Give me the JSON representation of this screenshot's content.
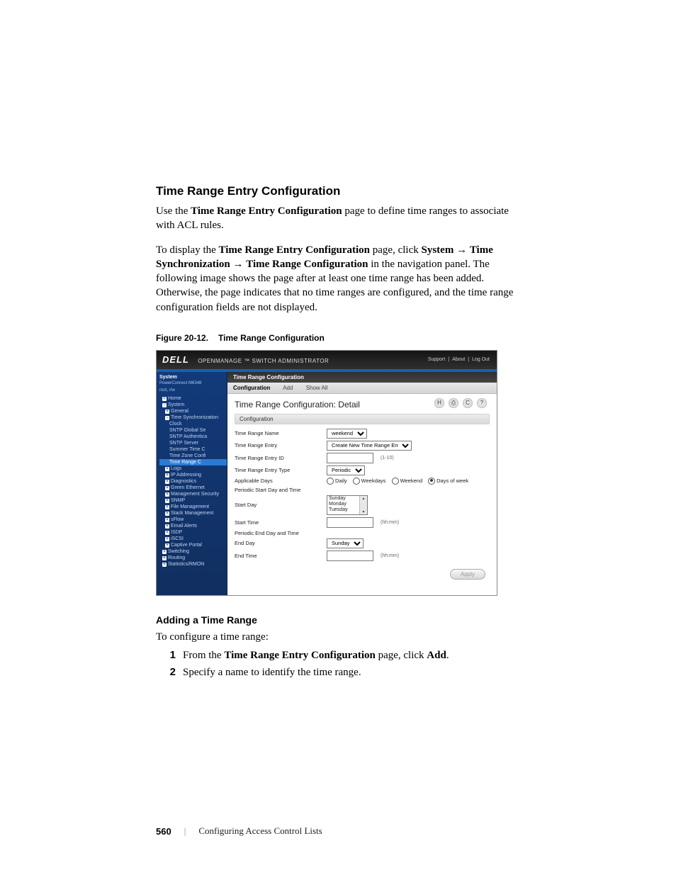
{
  "section_title": "Time Range Entry Configuration",
  "para1_a": "Use the ",
  "para1_b": "Time Range Entry Configuration",
  "para1_c": " page to define time ranges to associate with ACL rules.",
  "para2_a": "To display the ",
  "para2_b": "Time Range Entry Configuration",
  "para2_c": " page, click ",
  "para2_d": "System",
  "para2_e": "Time Synchronization",
  "para2_f": "Time Range Configuration",
  "para2_g": " in the navigation panel. The following image shows the page after at least one time range has been added. Otherwise, the page indicates that no time ranges are configured, and the time range configuration fields are not displayed.",
  "arrow": "→",
  "figure_caption_a": "Figure 20-12.",
  "figure_caption_b": "Time Range Configuration",
  "shot": {
    "brand": "DELL",
    "subbrand": "OPENMANAGE ™ SWITCH ADMINISTRATOR",
    "links": [
      "Support",
      "About",
      "Log Out"
    ],
    "side_title": "System",
    "side_info1": "PowerConnect M6348",
    "side_info2": "root, r/w",
    "tree": [
      {
        "t": "Home",
        "lv": 0,
        "e": "="
      },
      {
        "t": "System",
        "lv": 0,
        "e": "-"
      },
      {
        "t": "General",
        "lv": 1,
        "e": "+"
      },
      {
        "t": "Time Synchronization",
        "lv": 1,
        "e": "-"
      },
      {
        "t": "Clock",
        "lv": 2
      },
      {
        "t": "SNTP Global Se",
        "lv": 2
      },
      {
        "t": "SNTP Authentica",
        "lv": 2
      },
      {
        "t": "SNTP Server",
        "lv": 2
      },
      {
        "t": "Summer Time C",
        "lv": 2
      },
      {
        "t": "Time Zone Confi",
        "lv": 2
      },
      {
        "t": "Time Range C",
        "lv": 2,
        "sel": true
      },
      {
        "t": "Logs",
        "lv": 1,
        "e": "+"
      },
      {
        "t": "IP Addressing",
        "lv": 1,
        "e": "+"
      },
      {
        "t": "Diagnostics",
        "lv": 1,
        "e": "+"
      },
      {
        "t": "Green Ethernet",
        "lv": 1,
        "e": "+"
      },
      {
        "t": "Management Security",
        "lv": 1,
        "e": "+"
      },
      {
        "t": "SNMP",
        "lv": 1,
        "e": "+"
      },
      {
        "t": "File Management",
        "lv": 1,
        "e": "+"
      },
      {
        "t": "Stack Management",
        "lv": 1,
        "e": "+"
      },
      {
        "t": "sFlow",
        "lv": 1,
        "e": "+"
      },
      {
        "t": "Email Alerts",
        "lv": 1,
        "e": "+"
      },
      {
        "t": "ISDP",
        "lv": 1,
        "e": "+"
      },
      {
        "t": "iSCSI",
        "lv": 1,
        "e": "+"
      },
      {
        "t": "Captive Portal",
        "lv": 1,
        "e": "+"
      },
      {
        "t": "Switching",
        "lv": 0,
        "e": "+"
      },
      {
        "t": "Routing",
        "lv": 0,
        "e": "+"
      },
      {
        "t": "Statistics/RMON",
        "lv": 0,
        "e": "+"
      }
    ],
    "crumb": "Time Range Configuration",
    "tabs": [
      "Configuration",
      "Add",
      "Show All"
    ],
    "content_title": "Time Range Configuration: Detail",
    "subheader": "Configuration",
    "icons": [
      "H",
      "⎙",
      "C",
      "?"
    ],
    "rows": {
      "name_lab": "Time Range Name",
      "name_val": "weekend",
      "entry_lab": "Time Range Entry",
      "entry_val": "Create New Time Range Entry",
      "id_lab": "Time Range Entry ID",
      "id_hint": "(1-10)",
      "type_lab": "Time Range Entry Type",
      "type_val": "Periodic",
      "appdays_lab": "Applicable Days",
      "radios": [
        "Daily",
        "Weekdays",
        "Weekend",
        "Days of week"
      ],
      "pstart_hdr": "Periodic Start Day and Time",
      "startday_lab": "Start Day",
      "startday_opts": [
        "Sunday",
        "Monday",
        "Tuesday"
      ],
      "starttime_lab": "Start Time",
      "time_hint": "(hh:mm)",
      "pend_hdr": "Periodic End Day and Time",
      "endday_lab": "End Day",
      "endday_val": "Sunday",
      "endtime_lab": "End Time",
      "apply": "Apply"
    }
  },
  "sub_heading": "Adding a Time Range",
  "intro2": "To configure a time range:",
  "step1_a": "From the ",
  "step1_b": "Time Range Entry Configuration",
  "step1_c": " page, click ",
  "step1_d": "Add",
  "step1_e": ".",
  "step2": "Specify a name to identify the time range.",
  "page_number": "560",
  "footer_text": "Configuring Access Control Lists",
  "footer_sep": "|"
}
